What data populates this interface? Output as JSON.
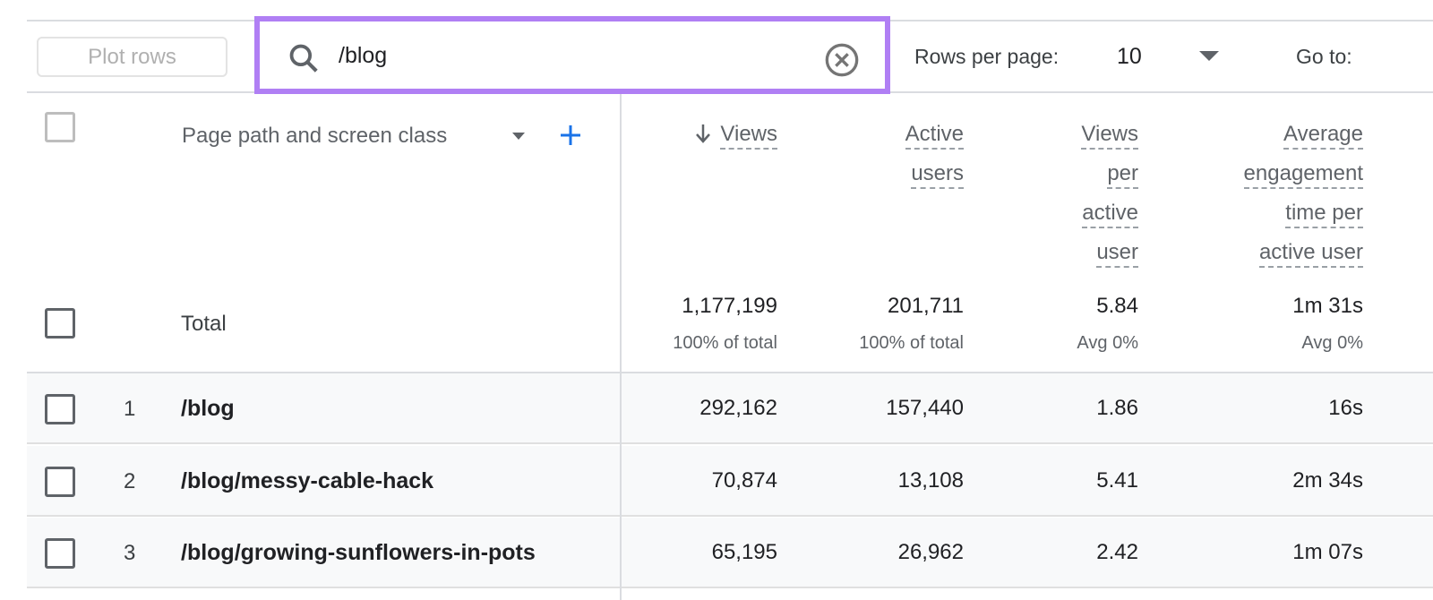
{
  "toolbar": {
    "plot_rows": "Plot rows",
    "search_value": "/blog",
    "rows_per_page_label": "Rows per page:",
    "rows_per_page": "10",
    "goto_label": "Go to:"
  },
  "colors": {
    "search_highlight": "#b07ff4",
    "accent": "#1a73e8"
  },
  "table": {
    "dimension_header": "Page path and screen class",
    "columns": [
      {
        "lines": [
          "Views"
        ],
        "sorted": "descending"
      },
      {
        "lines": [
          "Active",
          "users"
        ]
      },
      {
        "lines": [
          "Views",
          "per",
          "active",
          "user"
        ]
      },
      {
        "lines": [
          "Average",
          "engagement",
          "time per",
          "active user"
        ]
      }
    ],
    "total": {
      "label": "Total",
      "values": [
        "1,177,199",
        "201,711",
        "5.84",
        "1m 31s"
      ],
      "subs": [
        "100% of total",
        "100% of total",
        "Avg 0%",
        "Avg 0%"
      ]
    },
    "rows": [
      {
        "index": "1",
        "path": "/blog",
        "values": [
          "292,162",
          "157,440",
          "1.86",
          "16s"
        ]
      },
      {
        "index": "2",
        "path": "/blog/messy-cable-hack",
        "values": [
          "70,874",
          "13,108",
          "5.41",
          "2m 34s"
        ]
      },
      {
        "index": "3",
        "path": "/blog/growing-sunflowers-in-pots",
        "values": [
          "65,195",
          "26,962",
          "2.42",
          "1m 07s"
        ]
      }
    ]
  }
}
